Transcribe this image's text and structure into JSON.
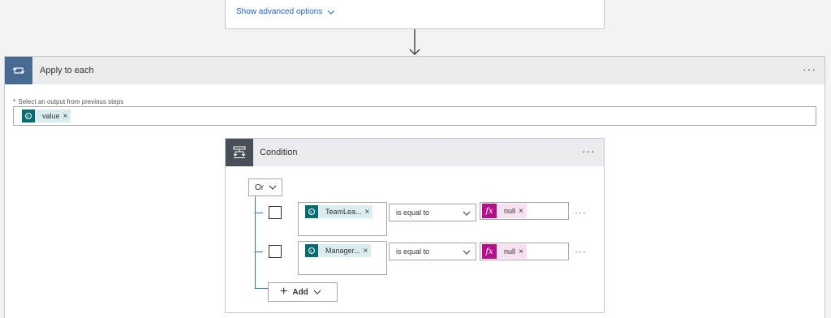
{
  "top_card": {
    "advanced_options_label": "Show advanced options"
  },
  "apply_to_each": {
    "title": "Apply to each",
    "more_label": "···",
    "select_label": "Select an output from previous steps",
    "required_marker": "*",
    "token": {
      "label": "value",
      "remove": "×",
      "icon": "sharepoint-icon"
    }
  },
  "condition": {
    "title": "Condition",
    "more_label": "···",
    "group_operator": "Or",
    "rows": [
      {
        "left_token": "TeamLea...",
        "operator": "is equal to",
        "right_token": "null",
        "remove": "×",
        "more": "···"
      },
      {
        "left_token": "Manager...",
        "operator": "is equal to",
        "right_token": "null",
        "remove": "×",
        "more": "···"
      }
    ],
    "add_label": "Add",
    "add_icon": "+",
    "fx_icon": "fx"
  },
  "colors": {
    "accent": "#2b7bc0",
    "apply_icon_bg": "#486991",
    "condition_icon_bg": "#484f58",
    "sharepoint": "#036c70",
    "expression": "#b40e8a",
    "link": "#2266c4"
  }
}
